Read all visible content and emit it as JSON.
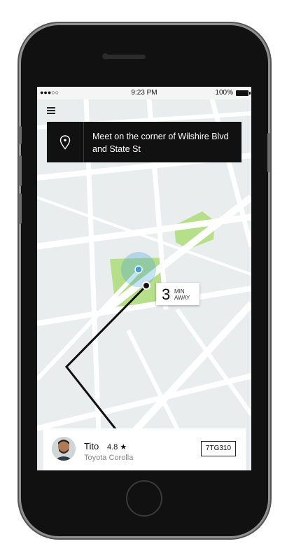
{
  "status_bar": {
    "signal": "●●●○○",
    "time": "9:23 PM",
    "battery": "100%"
  },
  "map": {
    "colors": {
      "land": "#e9eded",
      "road": "#ffffff",
      "park": "#b6df8a",
      "route": "#111111",
      "pickup": "#3e9fd6"
    }
  },
  "pickup_banner": {
    "text": "Meet on the corner of Wilshire Blvd and State St",
    "icon": "location-pin-icon"
  },
  "eta": {
    "minutes": "3",
    "unit_line1": "MIN",
    "unit_line2": "AWAY"
  },
  "driver": {
    "name": "Tito",
    "rating": "4.8 ★",
    "car": "Toyota Corolla",
    "plate": "7TG310"
  },
  "icons": [
    "menu-icon",
    "location-pin-icon",
    "battery-icon"
  ]
}
